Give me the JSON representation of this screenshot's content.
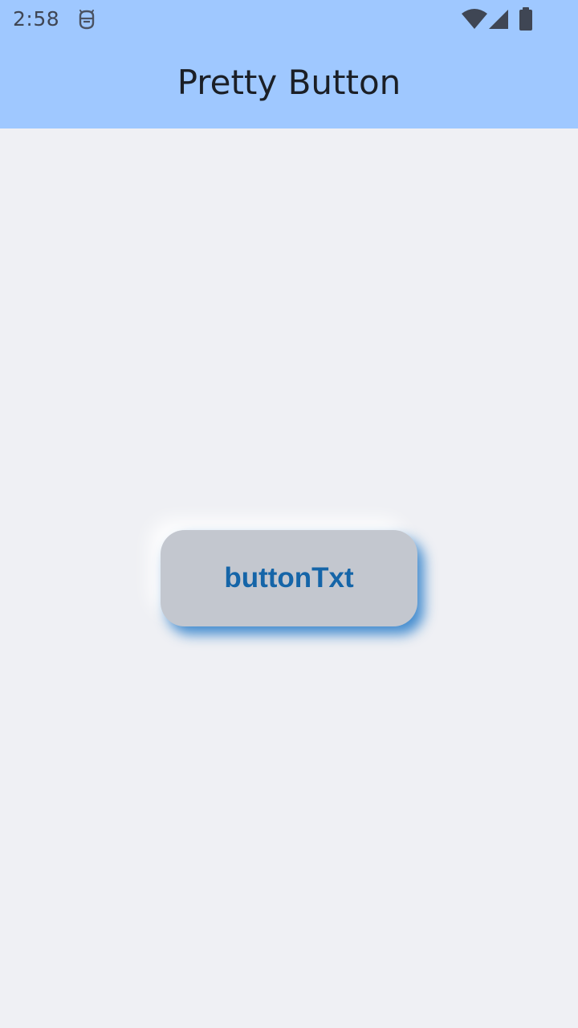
{
  "status_bar": {
    "time": "2:58",
    "icons": [
      "bug-debug-icon",
      "wifi-icon",
      "cellular-signal-icon",
      "battery-icon"
    ]
  },
  "app_bar": {
    "title": "Pretty Button"
  },
  "main": {
    "button_label": "buttonTxt"
  },
  "colors": {
    "app_bar_background": "#9fc8ff",
    "page_background": "#eff0f4",
    "button_background": "#c3c7cf",
    "button_text": "#1565a8",
    "button_shadow": "#136fc4"
  }
}
